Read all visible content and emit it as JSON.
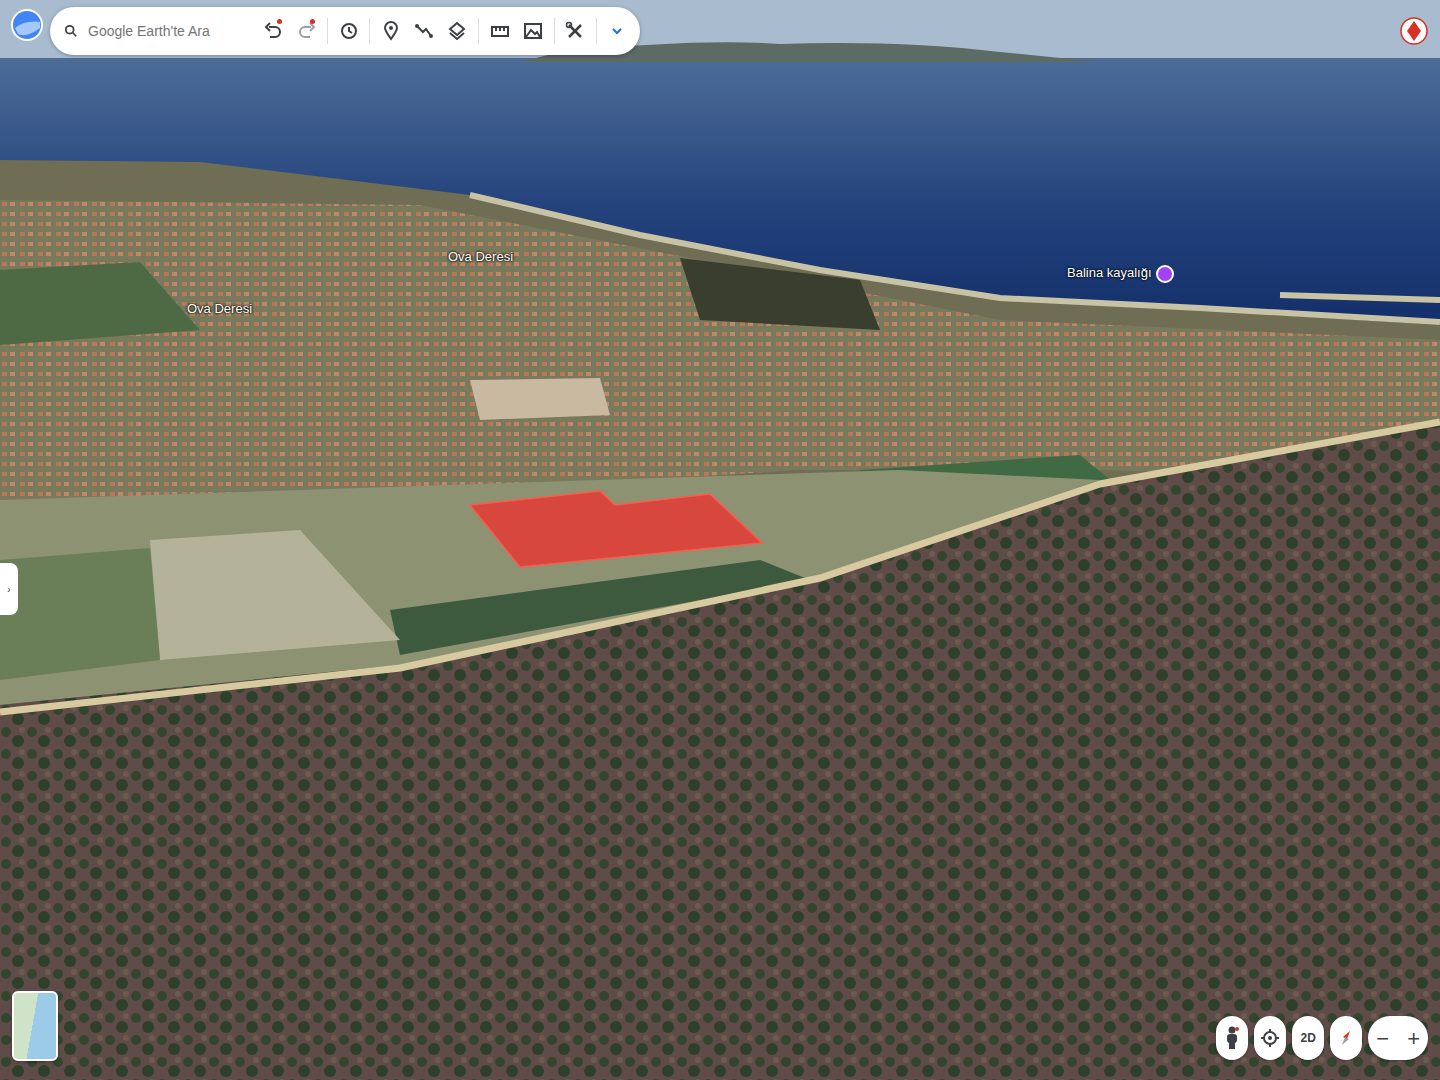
{
  "search": {
    "placeholder": "Google Earth'te Ara"
  },
  "map_labels": [
    {
      "text": "Ova Deresi",
      "kind": "river"
    },
    {
      "text": "Ova Deresi",
      "kind": "river"
    },
    {
      "text": "Balina kayalığı",
      "kind": "place"
    }
  ],
  "side_toggle": "›",
  "view_button": "2D",
  "zoom": {
    "out": "−",
    "in": "+"
  }
}
